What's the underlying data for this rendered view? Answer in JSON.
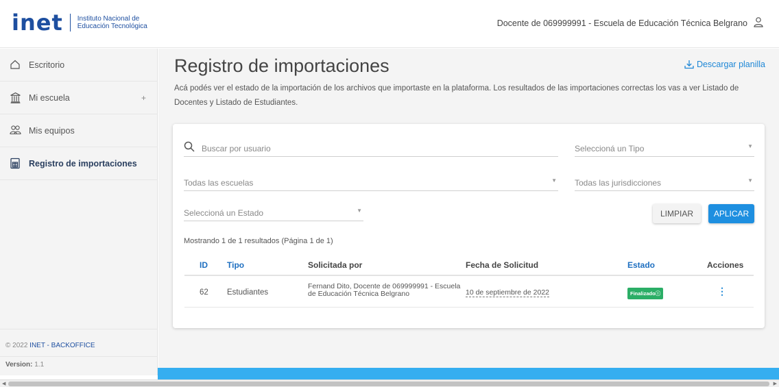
{
  "header": {
    "logo_text": "inet",
    "logo_sub_line1": "Instituto Nacional de",
    "logo_sub_line2": "Educación Tecnológica",
    "user_label": "Docente de 069999991 - Escuela de Educación Técnica Belgrano"
  },
  "sidebar": {
    "items": [
      {
        "label": "Escritorio"
      },
      {
        "label": "Mi escuela",
        "expand": "+"
      },
      {
        "label": "Mis equipos"
      },
      {
        "label": "Registro de importaciones"
      }
    ],
    "footer_copy_prefix": "© 2022 ",
    "footer_copy_brand": "INET - BACKOFFICE",
    "version_label": "Version:",
    "version_value": "1.1"
  },
  "main": {
    "title": "Registro de importaciones",
    "download_label": "Descargar planilla",
    "description": "Acá podés ver el estado de la importación de los archivos que importaste en la plataforma. Los resultados de las importaciones correctas los vas a ver Listado de Docentes y Listado de Estudiantes."
  },
  "filters": {
    "search_placeholder": "Buscar por usuario",
    "type_placeholder": "Seleccioná un Tipo",
    "schools_placeholder": "Todas las escuelas",
    "jurisdictions_placeholder": "Todas las jurisdicciones",
    "state_placeholder": "Seleccioná un Estado",
    "clear_label": "LIMPIAR",
    "apply_label": "APLICAR"
  },
  "results_text": "Mostrando 1 de 1 resultados (Página 1 de 1)",
  "table": {
    "headers": {
      "id": "ID",
      "tipo": "Tipo",
      "solicitada": "Solicitada por",
      "fecha": "Fecha de Solicitud",
      "estado": "Estado",
      "acciones": "Acciones"
    },
    "rows": [
      {
        "id": "62",
        "tipo": "Estudiantes",
        "solicitada_line1": "Fernand Dito, Docente de 069999991 - Escuela",
        "solicitada_line2": "de Educación Técnica Belgrano",
        "fecha": "10 de septiembre de 2022",
        "estado": "Finalizado",
        "acciones": "⋮"
      }
    ]
  },
  "colors": {
    "brand": "#1e4fa0",
    "link": "#1e87d6",
    "success": "#2bae66",
    "accent_bar": "#35aef0"
  }
}
